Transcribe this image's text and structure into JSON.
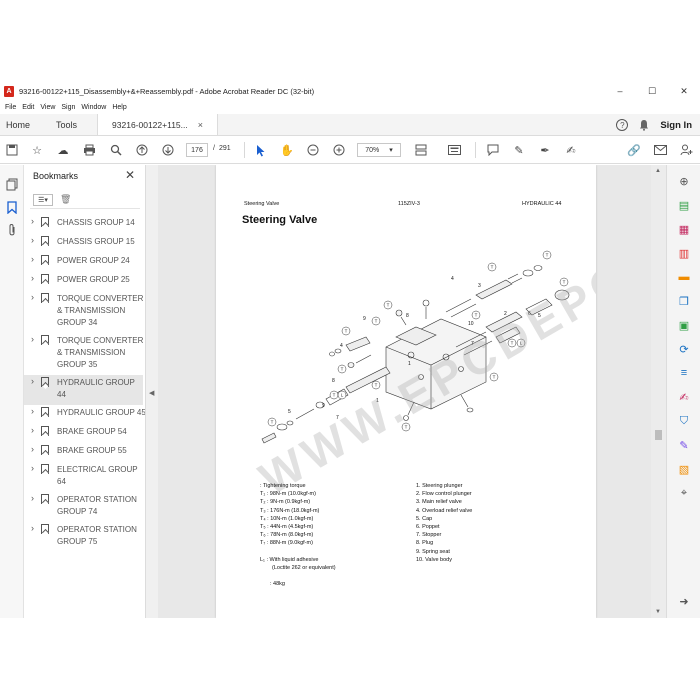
{
  "window": {
    "title": "93216-00122+115_Disassembly+&+Reassembly.pdf - Adobe Acrobat Reader DC (32-bit)",
    "app_icon": "A",
    "controls": [
      "–",
      "☐",
      "✕"
    ]
  },
  "menu": [
    "File",
    "Edit",
    "View",
    "Sign",
    "Window",
    "Help"
  ],
  "tabs": {
    "home": "Home",
    "tools": "Tools",
    "document": "93216-00122+115...",
    "close": "×",
    "help_icon": "?",
    "signin": "Sign In"
  },
  "toolbar": {
    "page_current": "176",
    "page_sep": "/",
    "page_total": "291",
    "zoom": "70%",
    "zoom_arrow": "▾"
  },
  "bookmarks": {
    "title": "Bookmarks",
    "close": "✕",
    "options_icon": "☰▾",
    "delete_icon": "🗑",
    "items": [
      {
        "label": "CHASSIS GROUP 14"
      },
      {
        "label": "CHASSIS GROUP 15"
      },
      {
        "label": "POWER GROUP 24"
      },
      {
        "label": "POWER GROUP 25"
      },
      {
        "label": "TORQUE CONVERTER & TRANSMISSION GROUP 34"
      },
      {
        "label": "TORQUE CONVERTER & TRANSMISSION GROUP 35"
      },
      {
        "label": "HYDRAULIC GROUP 44"
      },
      {
        "label": "HYDRAULIC GROUP 45"
      },
      {
        "label": "BRAKE GROUP 54"
      },
      {
        "label": "BRAKE GROUP 55"
      },
      {
        "label": "ELECTRICAL GROUP 64"
      },
      {
        "label": "OPERATOR STATION GROUP 74"
      },
      {
        "label": "OPERATOR STATION GROUP 75"
      }
    ]
  },
  "document": {
    "header_left": "Steering Valve",
    "header_center": "115ZIV-3",
    "header_right": "HYDRAULIC 44",
    "heading": "Steering Valve",
    "watermark": "WWW.EPCDEPO.COM",
    "torque_legend": [
      ": Tightening torque",
      "T₁ : 98N-m (10.0kgf-m)",
      "T₂ : 9N-m (0.9kgf-m)",
      "T₃ : 176N-m (18.0kgf-m)",
      "T₄ : 10N-m (1.0kgf-m)",
      "T₅ : 44N-m (4.5kgf-m)",
      "T₆ : 78N-m (8.0kgf-m)",
      "T₇ : 88N-m (9.0kgf-m)",
      "",
      "L₁ : With liquid adhesive",
      "(Loctite 262 or equivalent)",
      "",
      ": 48kg"
    ],
    "parts_legend": [
      "1.   Steering plunger",
      "2.   Flow control plunger",
      "3.   Main relief valve",
      "4.   Overload relief valve",
      "5.   Cap",
      "6.   Poppet",
      "7.   Stopper",
      "8.   Plug",
      "9.   Spring seat",
      "10.  Valve body"
    ]
  },
  "colors": {
    "accent": "#d4281c",
    "selected_bookmark": "#e6e6e6",
    "doc_background": "#e8e8e8"
  }
}
